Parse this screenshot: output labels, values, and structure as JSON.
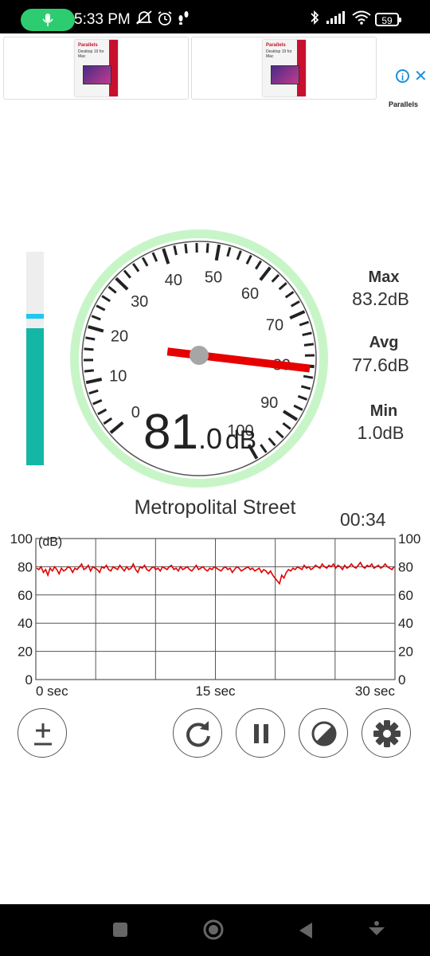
{
  "status_bar": {
    "time": "5:33 PM",
    "battery": "59"
  },
  "ad": {
    "card1_brand": "Parallels",
    "card1_product": "Desktop 19 for Mac",
    "card2_brand": "Parallels",
    "card2_product": "Desktop 19 for Mac",
    "sponsor": "Parallels",
    "adchoices_icon": "info-icon",
    "close_icon": "close-icon"
  },
  "meter": {
    "current_int": "81",
    "current_dec": ".0",
    "current_unit": "dB",
    "scale_labels": [
      "0",
      "10",
      "20",
      "30",
      "40",
      "50",
      "60",
      "70",
      "80",
      "90",
      "100"
    ],
    "level_fraction": 0.64,
    "peak_fraction": 0.71,
    "needle_value": 81
  },
  "stats": {
    "max_label": "Max",
    "max_value": "83.2",
    "max_unit": "dB",
    "avg_label": "Avg",
    "avg_value": "77.6",
    "avg_unit": "dB",
    "min_label": "Min",
    "min_value": "1.0",
    "min_unit": "dB"
  },
  "location": "Metropolital Street",
  "timer": "00:34",
  "chart_data": {
    "type": "line",
    "ylabel": "(dB)",
    "ylim": [
      0,
      100
    ],
    "yticks": [
      "100",
      "80",
      "60",
      "40",
      "20",
      "0"
    ],
    "xticks": [
      "0 sec",
      "15 sec",
      "30 sec"
    ],
    "xlim": [
      0,
      30
    ],
    "grid": true,
    "series": [
      {
        "values": [
          79,
          78,
          80,
          76,
          78,
          74,
          79,
          77,
          80,
          78,
          75,
          79,
          77,
          78,
          80,
          79,
          76,
          79,
          78,
          80,
          82,
          78,
          79,
          81,
          77,
          80,
          79,
          78,
          76,
          80,
          79,
          81,
          78,
          77,
          80,
          79,
          78,
          81,
          79,
          77,
          80,
          78,
          79,
          82,
          78,
          76,
          80,
          79,
          81,
          78,
          77,
          79,
          80,
          78,
          79,
          77,
          80,
          79,
          78,
          80,
          81,
          78,
          79,
          77,
          80,
          78,
          79,
          80,
          78,
          77,
          79,
          81,
          78,
          79,
          80,
          78,
          77,
          79,
          78,
          80,
          79,
          78,
          77,
          79,
          80,
          78,
          79,
          76,
          78,
          80,
          79,
          77,
          78,
          79,
          80,
          78,
          79,
          77,
          78,
          79,
          76,
          78,
          77,
          75,
          77,
          74,
          72,
          70,
          68,
          74,
          72,
          76,
          78,
          77,
          79,
          78,
          80,
          79,
          78,
          81,
          79,
          80,
          78,
          79,
          81,
          80,
          79,
          82,
          80,
          79,
          81,
          80,
          82,
          79,
          81,
          80,
          78,
          81,
          79,
          80,
          82,
          80,
          79,
          81,
          83,
          80,
          79,
          81,
          80,
          82,
          79,
          80,
          81,
          79,
          80,
          82,
          80,
          79,
          78,
          80
        ]
      }
    ]
  },
  "controls": {
    "calibrate_icon": "plus-minus-icon",
    "reset_icon": "refresh-icon",
    "pause_icon": "pause-icon",
    "theme_icon": "contrast-icon",
    "settings_icon": "gear-icon"
  },
  "nav": {
    "recents_icon": "square-icon",
    "home_icon": "circle-icon",
    "back_icon": "back-icon",
    "extra_icon": "accessibility-icon"
  }
}
